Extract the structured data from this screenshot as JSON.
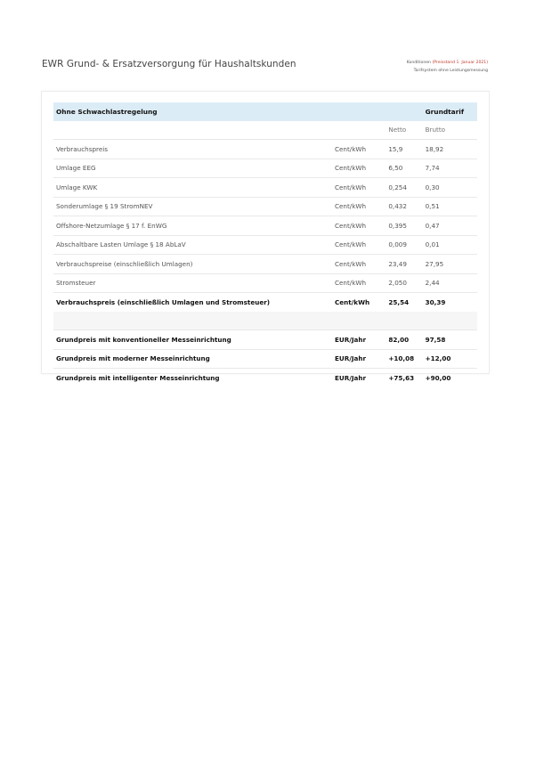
{
  "title": "EWR Grund- & Ersatzversorgung für Haushaltskunden",
  "meta": {
    "line1_prefix": "Konditionen",
    "line1_accent": "(Preisstand 1. Januar 2021)",
    "line2": "Tarifsystem ohne Leistungsmessung"
  },
  "table": {
    "header_left": "Ohne Schwachlastregelung",
    "header_right": "Grundtarif",
    "col_netto": "Netto",
    "col_brutto": "Brutto",
    "rows": [
      {
        "label": "Verbrauchspreis",
        "unit": "Cent/kWh",
        "netto": "15,9",
        "brutto": "18,92"
      },
      {
        "label": "Umlage EEG",
        "unit": "Cent/kWh",
        "netto": "6,50",
        "brutto": "7,74"
      },
      {
        "label": "Umlage KWK",
        "unit": "Cent/kWh",
        "netto": "0,254",
        "brutto": "0,30"
      },
      {
        "label": "Sonderumlage § 19 StromNEV",
        "unit": "Cent/kWh",
        "netto": "0,432",
        "brutto": "0,51"
      },
      {
        "label": "Offshore-Netzumlage § 17 f. EnWG",
        "unit": "Cent/kWh",
        "netto": "0,395",
        "brutto": "0,47"
      },
      {
        "label": "Abschaltbare Lasten Umlage § 18 AbLaV",
        "unit": "Cent/kWh",
        "netto": "0,009",
        "brutto": "0,01"
      },
      {
        "label": "Verbrauchspreise (einschließlich Umlagen)",
        "unit": "Cent/kWh",
        "netto": "23,49",
        "brutto": "27,95"
      },
      {
        "label": "Stromsteuer",
        "unit": "Cent/kWh",
        "netto": "2,050",
        "brutto": "2,44"
      }
    ],
    "total": {
      "label": "Verbrauchspreis (einschließlich Umlagen und Stromsteuer)",
      "unit": "Cent/kWh",
      "netto": "25,54",
      "brutto": "30,39"
    },
    "grundpreise": [
      {
        "label": "Grundpreis mit konventioneller Messeinrichtung",
        "unit": "EUR/Jahr",
        "netto": "82,00",
        "brutto": "97,58"
      },
      {
        "label": "Grundpreis mit moderner Messeinrichtung",
        "unit": "EUR/Jahr",
        "netto": "+10,08",
        "brutto": "+12,00"
      },
      {
        "label": "Grundpreis mit intelligenter Messeinrichtung",
        "unit": "EUR/Jahr",
        "netto": "+75,63",
        "brutto": "+90,00"
      }
    ]
  }
}
